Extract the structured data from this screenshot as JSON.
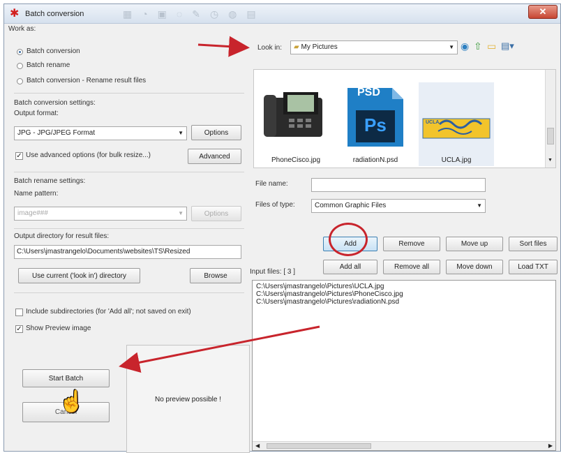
{
  "window": {
    "title": "Batch conversion",
    "close_label": "✕"
  },
  "work_as": {
    "heading": "Work as:",
    "options": [
      "Batch conversion",
      "Batch rename",
      "Batch conversion - Rename result files"
    ],
    "selected": 0
  },
  "conversion": {
    "heading": "Batch conversion settings:",
    "output_format_label": "Output format:",
    "output_format_value": "JPG - JPG/JPEG Format",
    "options_button": "Options",
    "advanced_checkbox": "Use advanced options (for bulk resize...)",
    "advanced_checked": true,
    "advanced_button": "Advanced"
  },
  "rename": {
    "heading": "Batch rename settings:",
    "pattern_label": "Name pattern:",
    "pattern_value": "image###",
    "options_button": "Options"
  },
  "output_dir": {
    "label": "Output directory for result files:",
    "value": "C:\\Users\\jmastrangelo\\Documents\\websites\\TS\\Resized",
    "use_current_button": "Use current ('look in') directory",
    "browse_button": "Browse"
  },
  "include_subdirs": {
    "label": "Include subdirectories (for 'Add all'; not saved on exit)",
    "checked": false
  },
  "show_preview": {
    "label": "Show Preview image",
    "checked": true
  },
  "start_batch_button": "Start Batch",
  "cancel_button": "Cancel",
  "preview_message": "No preview possible !",
  "look_in": {
    "label": "Look in:",
    "value": "My Pictures"
  },
  "files": [
    {
      "name": "PhoneCisco.jpg"
    },
    {
      "name": "radiationN.psd",
      "badge": "PSD",
      "glyph": "Ps"
    },
    {
      "name": "UCLA.jpg",
      "badge": "UCLA"
    }
  ],
  "file_name": {
    "label": "File name:",
    "value": ""
  },
  "files_of_type": {
    "label": "Files of type:",
    "value": "Common Graphic Files"
  },
  "list_buttons": {
    "add": "Add",
    "remove": "Remove",
    "move_up": "Move up",
    "sort_files": "Sort files",
    "add_all": "Add all",
    "remove_all": "Remove all",
    "move_down": "Move down",
    "load_txt": "Load TXT"
  },
  "input_files": {
    "label": "Input files: [ 3 ]",
    "items": [
      "C:\\Users\\jmastrangelo\\Pictures\\UCLA.jpg",
      "C:\\Users\\jmastrangelo\\Pictures\\PhoneCisco.jpg",
      "C:\\Users\\jmastrangelo\\Pictures\\radiationN.psd"
    ]
  },
  "colors": {
    "annotation": "#c8242c",
    "psd_blue": "#1f7fc6",
    "psd_dark": "#0d2a45"
  }
}
